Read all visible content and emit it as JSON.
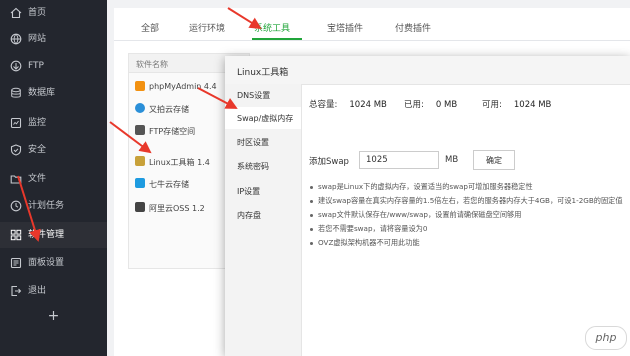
{
  "sidebar": {
    "items": [
      {
        "label": "首页",
        "icon": "home-icon",
        "active": false
      },
      {
        "label": "网站",
        "icon": "globe-icon",
        "active": false
      },
      {
        "label": "FTP",
        "icon": "ftp-icon",
        "active": false
      },
      {
        "label": "数据库",
        "icon": "database-icon",
        "active": false
      },
      {
        "label": "监控",
        "icon": "monitor-icon",
        "active": false
      },
      {
        "label": "安全",
        "icon": "shield-icon",
        "active": false
      },
      {
        "label": "文件",
        "icon": "folder-icon",
        "active": false
      },
      {
        "label": "计划任务",
        "icon": "clock-icon",
        "active": false
      },
      {
        "label": "软件管理",
        "icon": "grid-icon",
        "active": true
      },
      {
        "label": "面板设置",
        "icon": "settings-icon",
        "active": false
      },
      {
        "label": "退出",
        "icon": "logout-icon",
        "active": false
      }
    ],
    "add_label": "+"
  },
  "tabs": [
    {
      "label": "全部",
      "active": false
    },
    {
      "label": "运行环境",
      "active": false
    },
    {
      "label": "系统工具",
      "active": true
    },
    {
      "label": "宝塔插件",
      "active": false
    },
    {
      "label": "付费插件",
      "active": false
    }
  ],
  "software_list": {
    "header": "软件名称",
    "items": [
      {
        "label": "phpMyAdmin 4.4",
        "icon": "phpmyadmin-icon",
        "color": "#f29111"
      },
      {
        "label": "又拍云存储",
        "icon": "upyun-icon",
        "color": "#2a8fd8"
      },
      {
        "label": "FTP存储空间",
        "icon": "ftp-storage-icon",
        "color": "#555555"
      },
      {
        "label": "Linux工具箱 1.4",
        "icon": "toolbox-icon",
        "color": "#c8a13a"
      },
      {
        "label": "七牛云存储",
        "icon": "qiniu-icon",
        "color": "#1e9be0"
      },
      {
        "label": "阿里云OSS 1.2",
        "icon": "aliyun-oss-icon",
        "color": "#444444"
      }
    ]
  },
  "modal": {
    "title": "Linux工具箱",
    "nav": [
      {
        "label": "DNS设置",
        "active": false
      },
      {
        "label": "Swap/虚拟内存",
        "active": true
      },
      {
        "label": "时区设置",
        "active": false
      },
      {
        "label": "系统密码",
        "active": false
      },
      {
        "label": "IP设置",
        "active": false
      },
      {
        "label": "内存盘",
        "active": false
      }
    ],
    "stats": {
      "total_label": "总容量:",
      "total_value": "1024 MB",
      "used_label": "已用:",
      "used_value": "0 MB",
      "free_label": "可用:",
      "free_value": "1024 MB"
    },
    "swap": {
      "label": "添加Swap",
      "value": "1025",
      "unit": "MB",
      "button": "确定"
    },
    "tips": [
      "swap是Linux下的虚拟内存，设置适当的swap可增加服务器稳定性",
      "建议swap容量在真实内存容量的1.5倍左右，若您的服务器内存大于4GB，可设1-2GB的固定值",
      "swap文件默认保存在/www/swap，设置前请确保磁盘空间够用",
      "若您不需要swap，请将容量设为0",
      "OVZ虚拟架构机器不可用此功能"
    ]
  },
  "watermark": "php",
  "colors": {
    "sidebar_bg": "#23262e",
    "accent": "#20a53a",
    "arrow": "#e8382b"
  }
}
